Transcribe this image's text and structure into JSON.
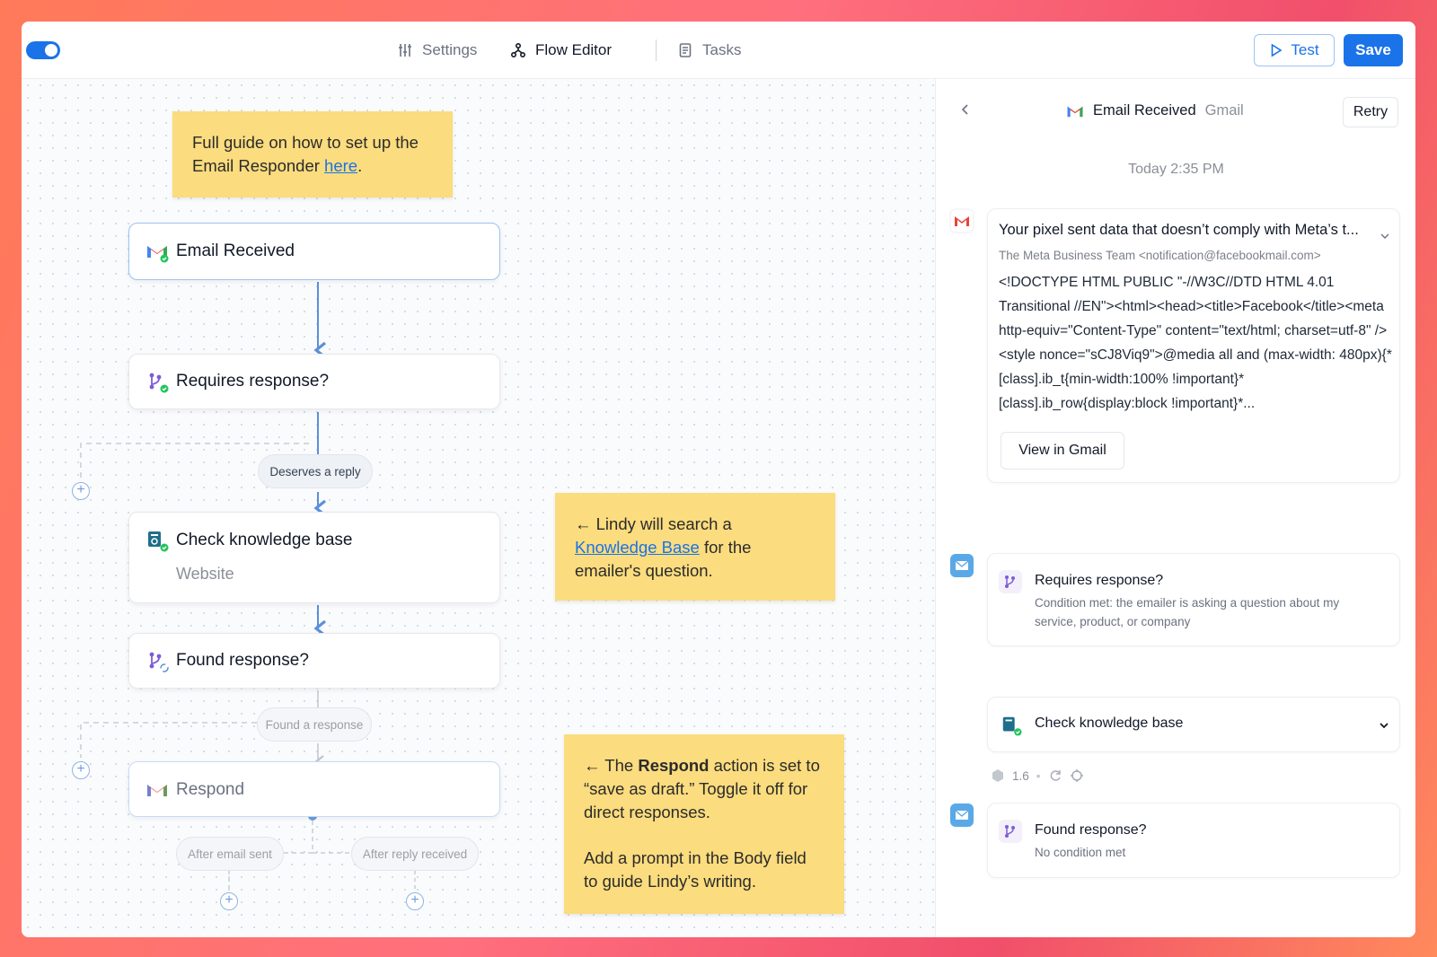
{
  "topbar": {
    "tabs": [
      {
        "label": "Settings",
        "icon": "sliders-icon"
      },
      {
        "label": "Flow Editor",
        "icon": "flow-icon"
      },
      {
        "label": "Tasks",
        "icon": "document-icon"
      }
    ],
    "test_label": "Test",
    "save_label": "Save"
  },
  "notes": {
    "guide_text": "Full guide on how to set up the Email Responder ",
    "guide_link": "here",
    "guide_end": ".",
    "kb_pre": "← Lindy will search a ",
    "kb_link": "Knowledge Base",
    "kb_post": " for the emailer's question.",
    "respond_pre": "← The ",
    "respond_bold": "Respond",
    "respond_post": " action is set to “save as draft.” Toggle it off for direct responses.",
    "respond_p2": "Add a prompt in the Body field to guide Lindy’s writing."
  },
  "flow": {
    "email_received": "Email Received",
    "requires_response": "Requires response?",
    "deserves_reply": "Deserves a reply",
    "check_kb": "Check knowledge base",
    "check_kb_sub": "Website",
    "found_response": "Found response?",
    "found_a_response": "Found a response",
    "respond": "Respond",
    "after_email_sent": "After email sent",
    "after_reply_received": "After reply received"
  },
  "panel": {
    "title": "Email Received",
    "source": "Gmail",
    "retry_label": "Retry",
    "timestamp": "Today 2:35 PM",
    "email": {
      "subject": "Your pixel sent data that doesn’t comply with Meta’s t...",
      "from": "The Meta Business Team <notification@facebookmail.com>",
      "body": "<!DOCTYPE HTML PUBLIC \"-//W3C//DTD HTML 4.01 Transitional //EN\"><html><head><title>Facebook</title><meta http-equiv=\"Content-Type\" content=\"text/html; charset=utf-8\" /><style nonce=\"sCJ8Viq9\">@media all and (max-width: 480px){*[class].ib_t{min-width:100% !important}*[class].ib_row{display:block !important}*...",
      "view_label": "View in Gmail"
    },
    "requires": {
      "title": "Requires response?",
      "text": "Condition met: the emailer is asking a question about my service, product, or company"
    },
    "check_kb": {
      "title": "Check knowledge base"
    },
    "meta_value": "1.6",
    "found": {
      "title": "Found response?",
      "text": "No condition met"
    }
  },
  "colors": {
    "accent": "#1a73e8",
    "note": "#fbdc7e",
    "gmail_red": "#ea4335"
  }
}
